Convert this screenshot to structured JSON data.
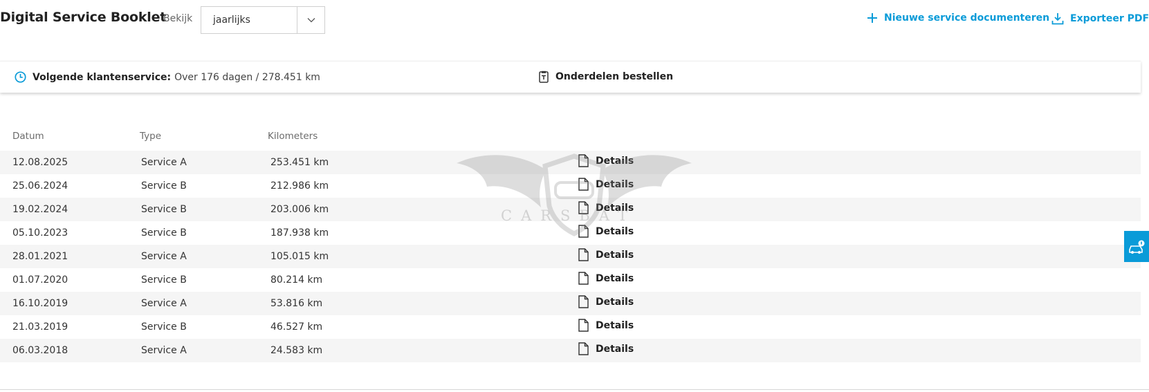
{
  "header": {
    "title": "Digital Service Booklet",
    "view_label": "Bekijk",
    "view_select": {
      "value": "jaarlijks"
    },
    "actions": {
      "new_service": "Nieuwe service documenteren",
      "export_pdf": "Exporteer PDF"
    }
  },
  "info_bar": {
    "next_service_label": "Volgende klantenservice:",
    "next_service_value": "Over 176 dagen / 278.451 km",
    "order_parts": "Onderdelen bestellen"
  },
  "table": {
    "headers": {
      "date": "Datum",
      "type": "Type",
      "km": "Kilometers"
    },
    "details_label": "Details",
    "rows": [
      {
        "date": "12.08.2025",
        "type": "Service A",
        "km": "253.451 km"
      },
      {
        "date": "25.06.2024",
        "type": "Service B",
        "km": "212.986 km"
      },
      {
        "date": "19.02.2024",
        "type": "Service B",
        "km": "203.006 km"
      },
      {
        "date": "05.10.2023",
        "type": "Service B",
        "km": "187.938 km"
      },
      {
        "date": "28.01.2021",
        "type": "Service A",
        "km": "105.015 km"
      },
      {
        "date": "01.07.2020",
        "type": "Service B",
        "km": "80.214 km"
      },
      {
        "date": "16.10.2019",
        "type": "Service A",
        "km": "53.816 km"
      },
      {
        "date": "21.03.2019",
        "type": "Service B",
        "km": "46.527 km"
      },
      {
        "date": "06.03.2018",
        "type": "Service A",
        "km": "24.583 km"
      }
    ]
  },
  "watermark": {
    "text": "CARSBAT"
  },
  "icons": {
    "select": "chevron-down-icon",
    "new_service": "plus-icon",
    "export": "download-icon",
    "next_service": "clock-icon",
    "order_parts": "clipboard-icon",
    "details": "document-icon",
    "side": "car-notification-icon"
  },
  "colors": {
    "accent": "#0a9bd8",
    "row_stripe": "#f5f5f5",
    "text": "#333333"
  }
}
